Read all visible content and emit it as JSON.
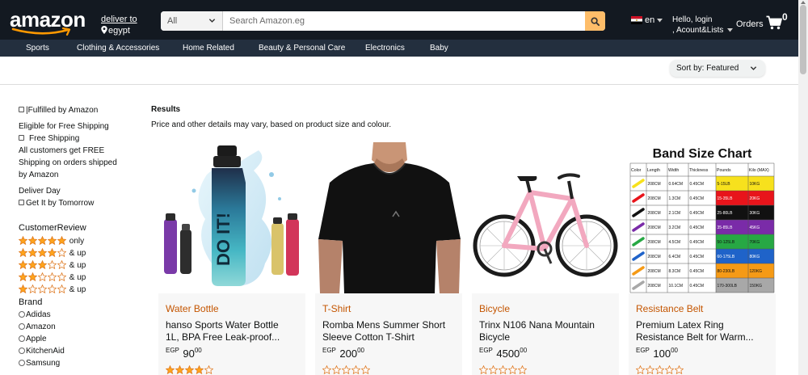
{
  "header": {
    "logo": "amazon",
    "deliver_line1": "deliver to",
    "deliver_line2": "egypt",
    "search_category": "All",
    "search_placeholder": "Search Amazon.eg",
    "language": "en",
    "account_line1": "Hello, login",
    "account_line2": ", Acount&Lists",
    "orders": "Orders",
    "cart_count": "0"
  },
  "subnav": [
    "Sports",
    "Clothing & Accessories",
    "Home Related",
    "Beauty & Personal Care",
    "Electronics",
    "Baby"
  ],
  "sort": {
    "label": "Sort by: Featured"
  },
  "sidebar": {
    "fulfilled": "|Fulfilled by Amazon",
    "free_ship_head": "Eligible for Free Shipping",
    "free_ship": "Free Shipping",
    "free_ship_desc1": "All customers get FREE",
    "free_ship_desc2": "Shipping on orders shipped",
    "free_ship_desc3": "by Amazon",
    "deliver_day": "Deliver Day",
    "tomorrow": "Get It by Tomorrow",
    "review_head": "CustomerReview",
    "reviews": [
      {
        "stars": 5,
        "label": "only"
      },
      {
        "stars": 4,
        "label": "& up"
      },
      {
        "stars": 3,
        "label": "& up"
      },
      {
        "stars": 2,
        "label": "& up"
      },
      {
        "stars": 1,
        "label": "& up"
      }
    ],
    "brand_head": "Brand",
    "brands": [
      "Adidas",
      "Amazon",
      "Apple",
      "KitchenAid",
      "Samsung"
    ]
  },
  "results": {
    "title": "Results",
    "subtitle": "Price and other details may vary, based on product size and colour."
  },
  "products": [
    {
      "category": "Water Bottle",
      "title_line1": "hanso Sports Water Bottle",
      "title_line2": "1L, BPA Free Leak-proof...",
      "currency": "EGP",
      "price_whole": "90",
      "price_fraction": "00",
      "rating": 4,
      "image_icon": "water-bottle-image",
      "bottle_text": "DO IT!"
    },
    {
      "category": "T-Shirt",
      "title_line1": "Romba Mens Summer Short",
      "title_line2": "Sleeve Cotton T-Shirt",
      "currency": "EGP",
      "price_whole": "200",
      "price_fraction": "00",
      "rating": 0,
      "image_icon": "tshirt-image"
    },
    {
      "category": "Bicycle",
      "title_line1": "Trinx N106 Nana Mountain",
      "title_line2": "Bicycle",
      "currency": "EGP",
      "price_whole": "4500",
      "price_fraction": "00",
      "rating": 0,
      "image_icon": "bicycle-image"
    },
    {
      "category": "Resistance Belt",
      "title_line1": "Premium Latex Ring",
      "title_line2": "Resistance Belt for Warm...",
      "currency": "EGP",
      "price_whole": "100",
      "price_fraction": "00",
      "rating": 0,
      "image_icon": "band-size-chart-image",
      "chart_title": "Band Size Chart",
      "chart_headers": [
        "Color",
        "Length",
        "Width",
        "Thickness",
        "Pounds",
        "Kilo (MAX)"
      ],
      "chart_rows": [
        [
          "208CM",
          "0.64CM",
          "0.45CM",
          "5-15LB",
          "10KG"
        ],
        [
          "208CM",
          "1.3CM",
          "0.45CM",
          "15-35LB",
          "20KG"
        ],
        [
          "208CM",
          "2.1CM",
          "0.45CM",
          "25-80LB",
          "30KG"
        ],
        [
          "208CM",
          "3.2CM",
          "0.45CM",
          "35-85LB",
          "45KG"
        ],
        [
          "208CM",
          "4.5CM",
          "0.45CM",
          "50-125LB",
          "70KG"
        ],
        [
          "208CM",
          "6.4CM",
          "0.45CM",
          "60-175LB",
          "80KG"
        ],
        [
          "208CM",
          "8.3CM",
          "0.45CM",
          "80-230LB",
          "120KG"
        ],
        [
          "208CM",
          "10.1CM",
          "0.45CM",
          "170-300LB",
          "150KG"
        ]
      ],
      "chart_colors": [
        "#f7e11d",
        "#e8141b",
        "#111111",
        "#7a2ba8",
        "#27a844",
        "#1f63c9",
        "#f59a16",
        "#a8a8a8"
      ]
    }
  ],
  "colors": {
    "nav_bg": "#131921",
    "subnav_bg": "#232f3e",
    "search_btn": "#febd69",
    "category": "#c45500",
    "star": "#ffa41c"
  }
}
